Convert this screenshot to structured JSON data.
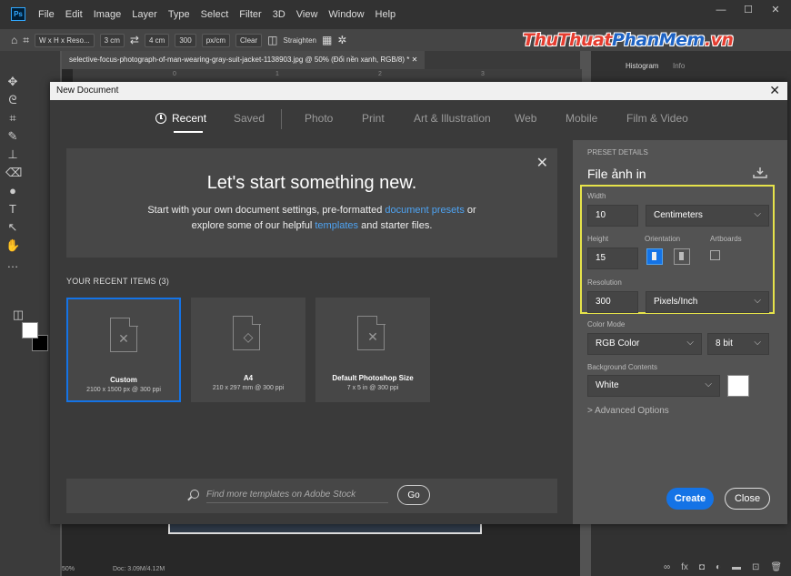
{
  "app": {
    "logo_text": "Ps",
    "menu": [
      "File",
      "Edit",
      "Image",
      "Layer",
      "Type",
      "Select",
      "Filter",
      "3D",
      "View",
      "Window",
      "Help"
    ],
    "window_controls": [
      "—",
      "☐",
      "✕"
    ]
  },
  "options_bar": {
    "ratio_select": "W x H x Reso...",
    "width_value": "3 cm",
    "height_value": "4 cm",
    "resolution_value": "300",
    "unit_select": "px/cm",
    "clear_label": "Clear",
    "straighten_label": "Straighten"
  },
  "watermark": {
    "part1": "ThuThuat",
    "part2": "PhanMem",
    "part3": ".vn"
  },
  "document_tab": {
    "title": "selective-focus-photograph-of-man-wearing-gray-suit-jacket-1138903.jpg @ 50% (Đổi nền xanh, RGB/8) *"
  },
  "ruler_ticks": [
    "0",
    "1",
    "2",
    "3"
  ],
  "status_bar": {
    "zoom": "50%",
    "doc_info": "Doc: 3.09M/4.12M"
  },
  "right_panel_tabs": [
    "Histogram",
    "Info"
  ],
  "dialog": {
    "title": "New Document",
    "tabs": [
      "Recent",
      "Saved",
      "Photo",
      "Print",
      "Art & Illustration",
      "Web",
      "Mobile",
      "Film & Video"
    ],
    "active_tab": "Recent",
    "welcome": {
      "title": "Let's start something new.",
      "line1_pre": "Start with your own document settings, pre-formatted ",
      "line1_link": "document presets",
      "line1_post": " or",
      "line2_pre": "explore some of our helpful ",
      "line2_link": "templates",
      "line2_post": " and starter files."
    },
    "recent_header": "YOUR RECENT ITEMS  (3)",
    "recent_items": [
      {
        "name": "Custom",
        "spec": "2100 x 1500 px @ 300 ppi",
        "selected": true
      },
      {
        "name": "A4",
        "spec": "210 x 297 mm @ 300 ppi",
        "selected": false
      },
      {
        "name": "Default Photoshop Size",
        "spec": "7 x 5 in @ 300 ppi",
        "selected": false
      }
    ],
    "search": {
      "placeholder": "Find more templates on Adobe Stock",
      "go_label": "Go"
    },
    "preset": {
      "section_label": "PRESET DETAILS",
      "title": "File ảnh in",
      "width_label": "Width",
      "width_value": "10",
      "width_unit": "Centimeters",
      "height_label": "Height",
      "height_value": "15",
      "orientation_label": "Orientation",
      "artboards_label": "Artboards",
      "resolution_label": "Resolution",
      "resolution_value": "300",
      "resolution_unit": "Pixels/Inch",
      "color_mode_label": "Color Mode",
      "color_mode_value": "RGB Color",
      "bit_depth": "8 bit",
      "background_label": "Background Contents",
      "background_value": "White",
      "advanced_label": "> Advanced Options",
      "create_label": "Create",
      "close_label": "Close"
    }
  },
  "colors": {
    "accent": "#1473e6",
    "highlight": "#e6e34a",
    "link": "#4ea3f2"
  }
}
